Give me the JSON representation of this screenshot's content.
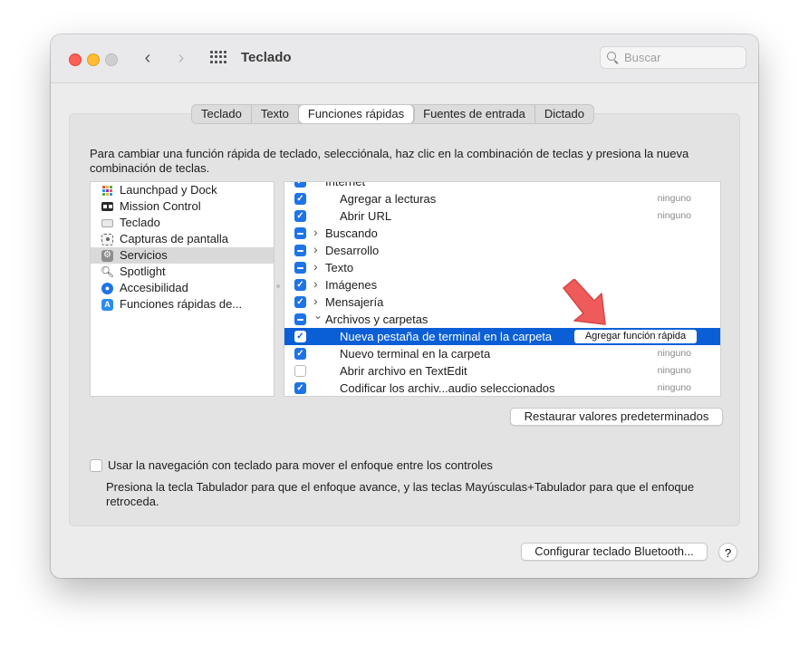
{
  "window": {
    "title": "Teclado"
  },
  "search": {
    "placeholder": "Buscar"
  },
  "tabs": [
    {
      "label": "Teclado",
      "active": false
    },
    {
      "label": "Texto",
      "active": false
    },
    {
      "label": "Funciones rápidas",
      "active": true
    },
    {
      "label": "Fuentes de entrada",
      "active": false
    },
    {
      "label": "Dictado",
      "active": false
    }
  ],
  "description": "Para cambiar una función rápida de teclado, selecciónala, haz clic en la combinación de teclas y presiona la nueva combinación de teclas.",
  "categories": [
    {
      "label": "Launchpad y Dock",
      "icon": "launchpad-icon"
    },
    {
      "label": "Mission Control",
      "icon": "mission-control-icon"
    },
    {
      "label": "Teclado",
      "icon": "keyboard-icon"
    },
    {
      "label": "Capturas de pantalla",
      "icon": "screenshot-icon"
    },
    {
      "label": "Servicios",
      "icon": "gear-icon",
      "selected": true
    },
    {
      "label": "Spotlight",
      "icon": "spotlight-icon"
    },
    {
      "label": "Accesibilidad",
      "icon": "accessibility-icon"
    },
    {
      "label": "Funciones rápidas de...",
      "icon": "app-store-icon"
    }
  ],
  "shortcuts": [
    {
      "label": "Internet",
      "check": "on",
      "disclosure": "open",
      "indent": 1,
      "key": ""
    },
    {
      "label": "Agregar a lecturas",
      "check": "on",
      "indent": 2,
      "key": "ninguno"
    },
    {
      "label": "Abrir URL",
      "check": "on",
      "indent": 2,
      "key": "ninguno"
    },
    {
      "label": "Buscando",
      "check": "mixed",
      "disclosure": "closed",
      "indent": 1,
      "key": ""
    },
    {
      "label": "Desarrollo",
      "check": "mixed",
      "disclosure": "closed",
      "indent": 1,
      "key": ""
    },
    {
      "label": "Texto",
      "check": "mixed",
      "disclosure": "closed",
      "indent": 1,
      "key": ""
    },
    {
      "label": "Imágenes",
      "check": "on",
      "disclosure": "closed",
      "indent": 1,
      "key": ""
    },
    {
      "label": "Mensajería",
      "check": "on",
      "disclosure": "closed",
      "indent": 1,
      "key": ""
    },
    {
      "label": "Archivos y carpetas",
      "check": "mixed",
      "disclosure": "open",
      "indent": 1,
      "key": ""
    },
    {
      "label": "Nueva pestaña de terminal en la carpeta",
      "check": "on",
      "indent": 2,
      "key": "",
      "selected": true,
      "action": "Agregar función rápida"
    },
    {
      "label": "Nuevo terminal en la carpeta",
      "check": "on",
      "indent": 2,
      "key": "ninguno"
    },
    {
      "label": "Abrir archivo en TextEdit",
      "check": "off",
      "indent": 2,
      "key": "ninguno"
    },
    {
      "label": "Codificar los archiv...audio seleccionados",
      "check": "on",
      "indent": 2,
      "key": "ninguno"
    }
  ],
  "buttons": {
    "restore": "Restaurar valores predeterminados",
    "bluetooth": "Configurar teclado Bluetooth...",
    "help": "?"
  },
  "keyboard_nav": {
    "label": "Usar la navegación con teclado para mover el enfoque entre los controles",
    "hint": "Presiona la tecla Tabulador para que el enfoque avance, y las teclas Mayúsculas+Tabulador para que el enfoque retroceda.",
    "checked": false
  },
  "colors": {
    "accent": "#0a5fd6",
    "checkbox": "#1f73e8",
    "annotation_arrow": "#ef5a5a"
  }
}
